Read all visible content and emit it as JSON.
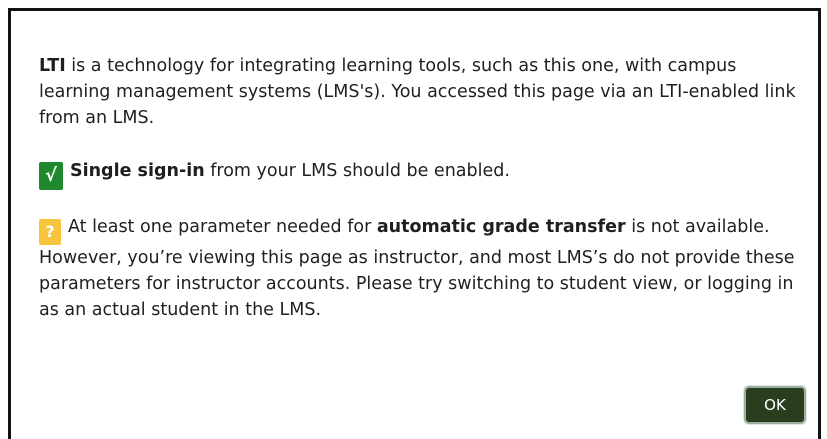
{
  "dialog": {
    "intro": {
      "term": "LTI",
      "text": " is a technology for integrating learning tools, such as this one, with campus learning management systems (LMS's). You accessed this page via an LTI-enabled link from an LMS."
    },
    "single_sign_in": {
      "badge": "√",
      "badge_color": "#1e8a2d",
      "term": "Single sign-in",
      "text": " from your LMS should be enabled."
    },
    "grade_transfer": {
      "badge": "?",
      "badge_color": "#f7c43c",
      "text_before": "At least one parameter needed for ",
      "term": "automatic grade transfer",
      "text_after": " is not available. However, you’re viewing this page as instructor, and most LMS’s do not provide these parameters for instructor accounts. Please try switching to student view, or logging in as an actual student in the LMS."
    },
    "ok_label": "OK",
    "ok_color": "#2a3d1f"
  }
}
